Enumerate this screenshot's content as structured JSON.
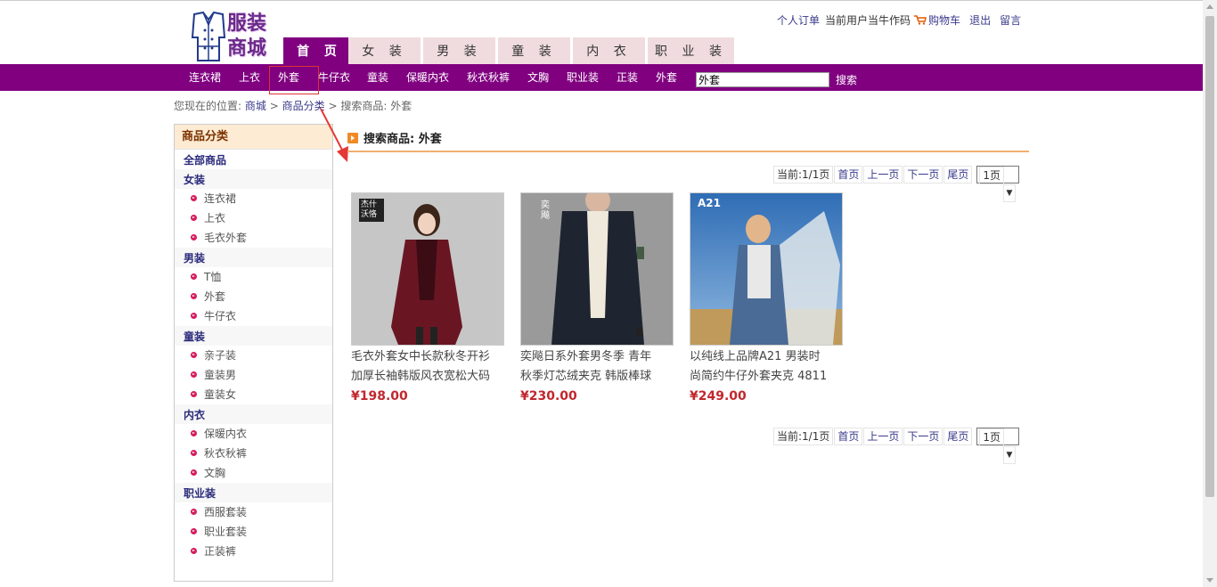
{
  "site": {
    "logo_text_line1": "服装",
    "logo_text_line2": "商城"
  },
  "toplinks": {
    "orders": "个人订单",
    "user_prefix": "当前用户",
    "username": "当牛作码",
    "cart": "购物车",
    "logout": "退出",
    "message": "留言"
  },
  "nav_tabs": [
    "首 页",
    "女 装",
    "男 装",
    "童 装",
    "内 衣",
    "职 业 装"
  ],
  "subnav": [
    "连衣裙",
    "上衣",
    "外套",
    "牛仔衣",
    "童装",
    "保暖内衣",
    "秋衣秋裤",
    "文胸",
    "职业装",
    "正装",
    "外套"
  ],
  "search": {
    "value": "外套",
    "button": "搜索"
  },
  "breadcrumb": {
    "prefix": "您现在的位置:",
    "home": "商城",
    "sep": ">",
    "category": "商品分类",
    "current": "搜索商品: 外套"
  },
  "sidebar": {
    "title": "商品分类",
    "all": "全部商品",
    "groups": [
      {
        "name": "女装",
        "items": [
          "连衣裙",
          "上衣",
          "毛衣外套"
        ]
      },
      {
        "name": "男装",
        "items": [
          "T恤",
          "外套",
          "牛仔衣"
        ]
      },
      {
        "name": "童装",
        "items": [
          "亲子装",
          "童装男",
          "童装女"
        ]
      },
      {
        "name": "内衣",
        "items": [
          "保暖内衣",
          "秋衣秋裤",
          "文胸"
        ]
      },
      {
        "name": "职业装",
        "items": [
          "西服套装",
          "职业套装",
          "正装裤"
        ]
      }
    ]
  },
  "section_title": "搜索商品: 外套",
  "pager": {
    "current": "当前:1/1页",
    "first": "首页",
    "prev": "上一页",
    "next": "下一页",
    "last": "尾页",
    "select": "1页"
  },
  "products": [
    {
      "name_line1": "毛衣外套女中长款秋冬开衫",
      "name_line2": "加厚长袖韩版风衣宽松大码",
      "price": "¥198.00",
      "img_text": "杰什 沃恪"
    },
    {
      "name_line1": "奕飚日系外套男冬季 青年",
      "name_line2": "秋季灯芯绒夹克 韩版棒球",
      "price": "¥230.00",
      "img_text": "奕飚"
    },
    {
      "name_line1": "以纯线上品牌A21 男装时",
      "name_line2": "尚简约牛仔外套夹克 4811",
      "price": "¥249.00",
      "img_text": "A21"
    }
  ],
  "colors": {
    "brand_purple": "#800080",
    "tab_pink": "#f0dcdf",
    "price_red": "#c1272d",
    "accent_orange": "#f08a24"
  }
}
